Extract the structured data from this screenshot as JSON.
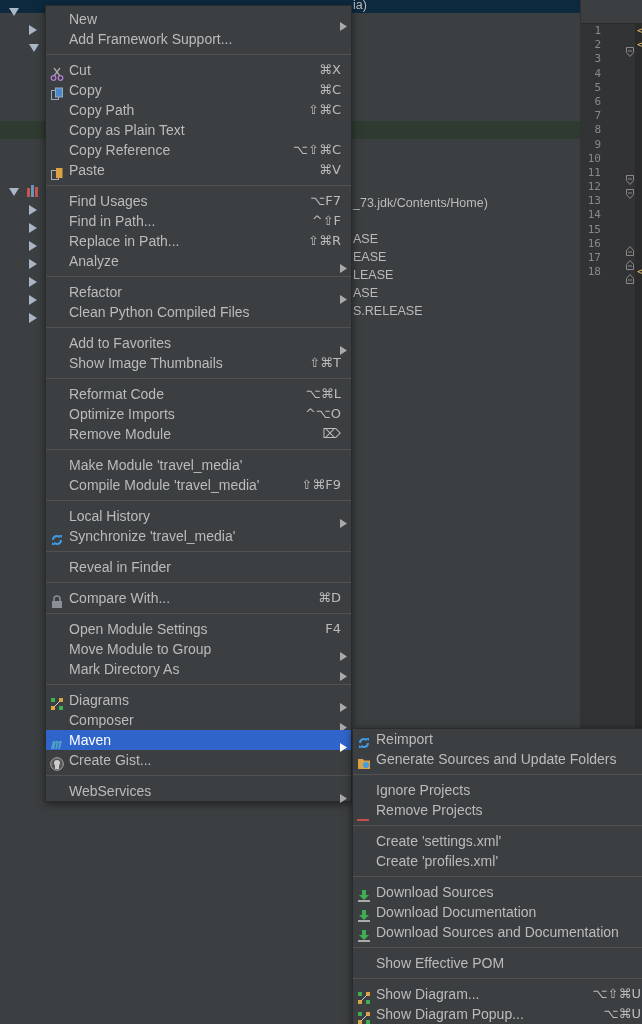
{
  "tree": {
    "nodes": [
      {
        "expanded": true,
        "selected": true,
        "label": "ia)",
        "children": [
          {
            "expanded": false
          },
          {
            "expanded": true,
            "children": [
              {
                "selected": true
              }
            ]
          }
        ]
      },
      {
        "expanded": true,
        "kind": "library",
        "children": [
          {
            "expanded": false,
            "label": "_73.jdk/Contents/Home)"
          },
          {
            "expanded": false
          },
          {
            "expanded": false,
            "label": "ASE"
          },
          {
            "expanded": false,
            "label": "EASE"
          },
          {
            "expanded": false,
            "label": "LEASE"
          },
          {
            "expanded": false,
            "label": "ASE"
          },
          {
            "expanded": false,
            "label": "S.RELEASE"
          }
        ]
      }
    ]
  },
  "editor": {
    "lines": [
      {
        "number": "1",
        "code": "<"
      },
      {
        "number": "2",
        "code": "<",
        "kind": "fold-start"
      },
      {
        "number": "3"
      },
      {
        "number": "4"
      },
      {
        "number": "5"
      },
      {
        "number": "6"
      },
      {
        "number": "7"
      },
      {
        "number": "8"
      },
      {
        "number": "9"
      },
      {
        "number": "10"
      },
      {
        "number": "11",
        "kind": "fold-start"
      },
      {
        "number": "12",
        "kind": "fold-start"
      },
      {
        "number": "13"
      },
      {
        "number": "14"
      },
      {
        "number": "15"
      },
      {
        "number": "16",
        "kind": "fold-end"
      },
      {
        "number": "17",
        "kind": "fold-end"
      },
      {
        "number": "18",
        "code": "<",
        "kind": "fold-end"
      }
    ]
  },
  "context_menu": {
    "groups": [
      [
        {
          "label": "New",
          "submenu": true,
          "selected": false
        },
        {
          "label": "Add Framework Support...",
          "selected": false
        }
      ],
      [
        {
          "label": "Cut",
          "shortcut": "⌘X",
          "kind": "cut",
          "selected": false
        },
        {
          "label": "Copy",
          "shortcut": "⌘C",
          "kind": "copy",
          "selected": false
        },
        {
          "label": "Copy Path",
          "shortcut": "⇧⌘C",
          "selected": false
        },
        {
          "label": "Copy as Plain Text",
          "selected": false
        },
        {
          "label": "Copy Reference",
          "shortcut": "⌥⇧⌘C",
          "selected": false
        },
        {
          "label": "Paste",
          "shortcut": "⌘V",
          "kind": "paste",
          "selected": false
        }
      ],
      [
        {
          "label": "Find Usages",
          "shortcut": "⌥F7",
          "selected": false
        },
        {
          "label": "Find in Path...",
          "shortcut": "^⇧F",
          "selected": false
        },
        {
          "label": "Replace in Path...",
          "shortcut": "⇧⌘R",
          "selected": false
        },
        {
          "label": "Analyze",
          "submenu": true,
          "selected": false
        }
      ],
      [
        {
          "label": "Refactor",
          "submenu": true,
          "selected": false
        },
        {
          "label": "Clean Python Compiled Files",
          "selected": false
        }
      ],
      [
        {
          "label": "Add to Favorites",
          "submenu": true,
          "selected": false
        },
        {
          "label": "Show Image Thumbnails",
          "shortcut": "⇧⌘T",
          "selected": false
        }
      ],
      [
        {
          "label": "Reformat Code",
          "shortcut": "⌥⌘L",
          "selected": false
        },
        {
          "label": "Optimize Imports",
          "shortcut": "^⌥O",
          "selected": false
        },
        {
          "label": "Remove Module",
          "shortcut": "⌦",
          "selected": false
        }
      ],
      [
        {
          "label": "Make Module 'travel_media'",
          "selected": false
        },
        {
          "label": "Compile Module 'travel_media'",
          "shortcut": "⇧⌘F9",
          "selected": false
        }
      ],
      [
        {
          "label": "Local History",
          "submenu": true,
          "selected": false
        },
        {
          "label": "Synchronize 'travel_media'",
          "kind": "sync",
          "selected": false
        }
      ],
      [
        {
          "label": "Reveal in Finder",
          "selected": false
        }
      ],
      [
        {
          "label": "Compare With...",
          "shortcut": "⌘D",
          "kind": "compare",
          "selected": false
        }
      ],
      [
        {
          "label": "Open Module Settings",
          "shortcut": "F4",
          "selected": false
        },
        {
          "label": "Move Module to Group",
          "submenu": true,
          "selected": false
        },
        {
          "label": "Mark Directory As",
          "submenu": true,
          "selected": false
        }
      ],
      [
        {
          "label": "Diagrams",
          "submenu": true,
          "kind": "diagram",
          "selected": false
        },
        {
          "label": "Composer",
          "submenu": true,
          "selected": false
        },
        {
          "label": "Maven",
          "submenu": true,
          "kind": "maven",
          "selected": true
        },
        {
          "label": "Create Gist...",
          "kind": "gist",
          "selected": false
        }
      ],
      [
        {
          "label": "WebServices",
          "submenu": true,
          "selected": false
        }
      ]
    ]
  },
  "submenu": {
    "groups": [
      [
        {
          "label": "Reimport",
          "kind": "sync",
          "selected": false
        },
        {
          "label": "Generate Sources and Update Folders",
          "kind": "folder-sync",
          "selected": false
        }
      ],
      [
        {
          "label": "Ignore Projects",
          "selected": false
        },
        {
          "label": "Remove Projects",
          "kind": "minus",
          "selected": false
        }
      ],
      [
        {
          "label": "Create 'settings.xml'",
          "selected": false
        },
        {
          "label": "Create 'profiles.xml'",
          "selected": false
        }
      ],
      [
        {
          "label": "Download Sources",
          "kind": "download",
          "selected": false
        },
        {
          "label": "Download Documentation",
          "kind": "download",
          "selected": false
        },
        {
          "label": "Download Sources and Documentation",
          "kind": "download",
          "selected": false
        }
      ],
      [
        {
          "label": "Show Effective POM",
          "selected": false
        }
      ],
      [
        {
          "label": "Show Diagram...",
          "shortcut": "⌥⇧⌘U",
          "kind": "diagram",
          "selected": false
        },
        {
          "label": "Show Diagram Popup...",
          "shortcut": "⌥⌘U",
          "kind": "diagram",
          "selected": false
        }
      ]
    ]
  }
}
